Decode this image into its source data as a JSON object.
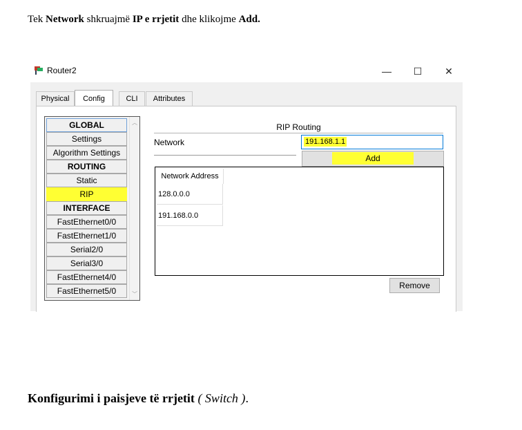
{
  "intro": {
    "part1": "Tek ",
    "network_bold": "Network",
    "part2": " shkruajmë ",
    "ip_bold": "IP e rrjetit",
    "part3": " dhe klikojme ",
    "add_bold": "Add."
  },
  "window": {
    "title": "Router2",
    "minimize": "—",
    "maximize": "☐",
    "close": "✕"
  },
  "tabs": [
    "Physical",
    "Config",
    "CLI",
    "Attributes"
  ],
  "active_tab": "Config",
  "nav": {
    "items": [
      {
        "label": "GLOBAL",
        "type": "header"
      },
      {
        "label": "Settings",
        "type": "item"
      },
      {
        "label": "Algorithm Settings",
        "type": "item"
      },
      {
        "label": "ROUTING",
        "type": "header"
      },
      {
        "label": "Static",
        "type": "item"
      },
      {
        "label": "RIP",
        "type": "item"
      },
      {
        "label": "INTERFACE",
        "type": "header"
      },
      {
        "label": "FastEthernet0/0",
        "type": "item"
      },
      {
        "label": "FastEthernet1/0",
        "type": "item"
      },
      {
        "label": "Serial2/0",
        "type": "item"
      },
      {
        "label": "Serial3/0",
        "type": "item"
      },
      {
        "label": "FastEthernet4/0",
        "type": "item"
      },
      {
        "label": "FastEthernet5/0",
        "type": "item"
      }
    ]
  },
  "rip": {
    "title": "RIP Routing",
    "network_label": "Network",
    "network_value": "191.168.1.1",
    "add_label": "Add",
    "table_header": "Network Address",
    "addresses": [
      "128.0.0.0",
      "191.168.0.0"
    ],
    "remove_label": "Remove"
  },
  "highlight_color": "#ffff33",
  "footer": {
    "bold": "Konfigurimi i paisjeve të rrjetit",
    "italic": " ( Switch )",
    "end": "."
  }
}
